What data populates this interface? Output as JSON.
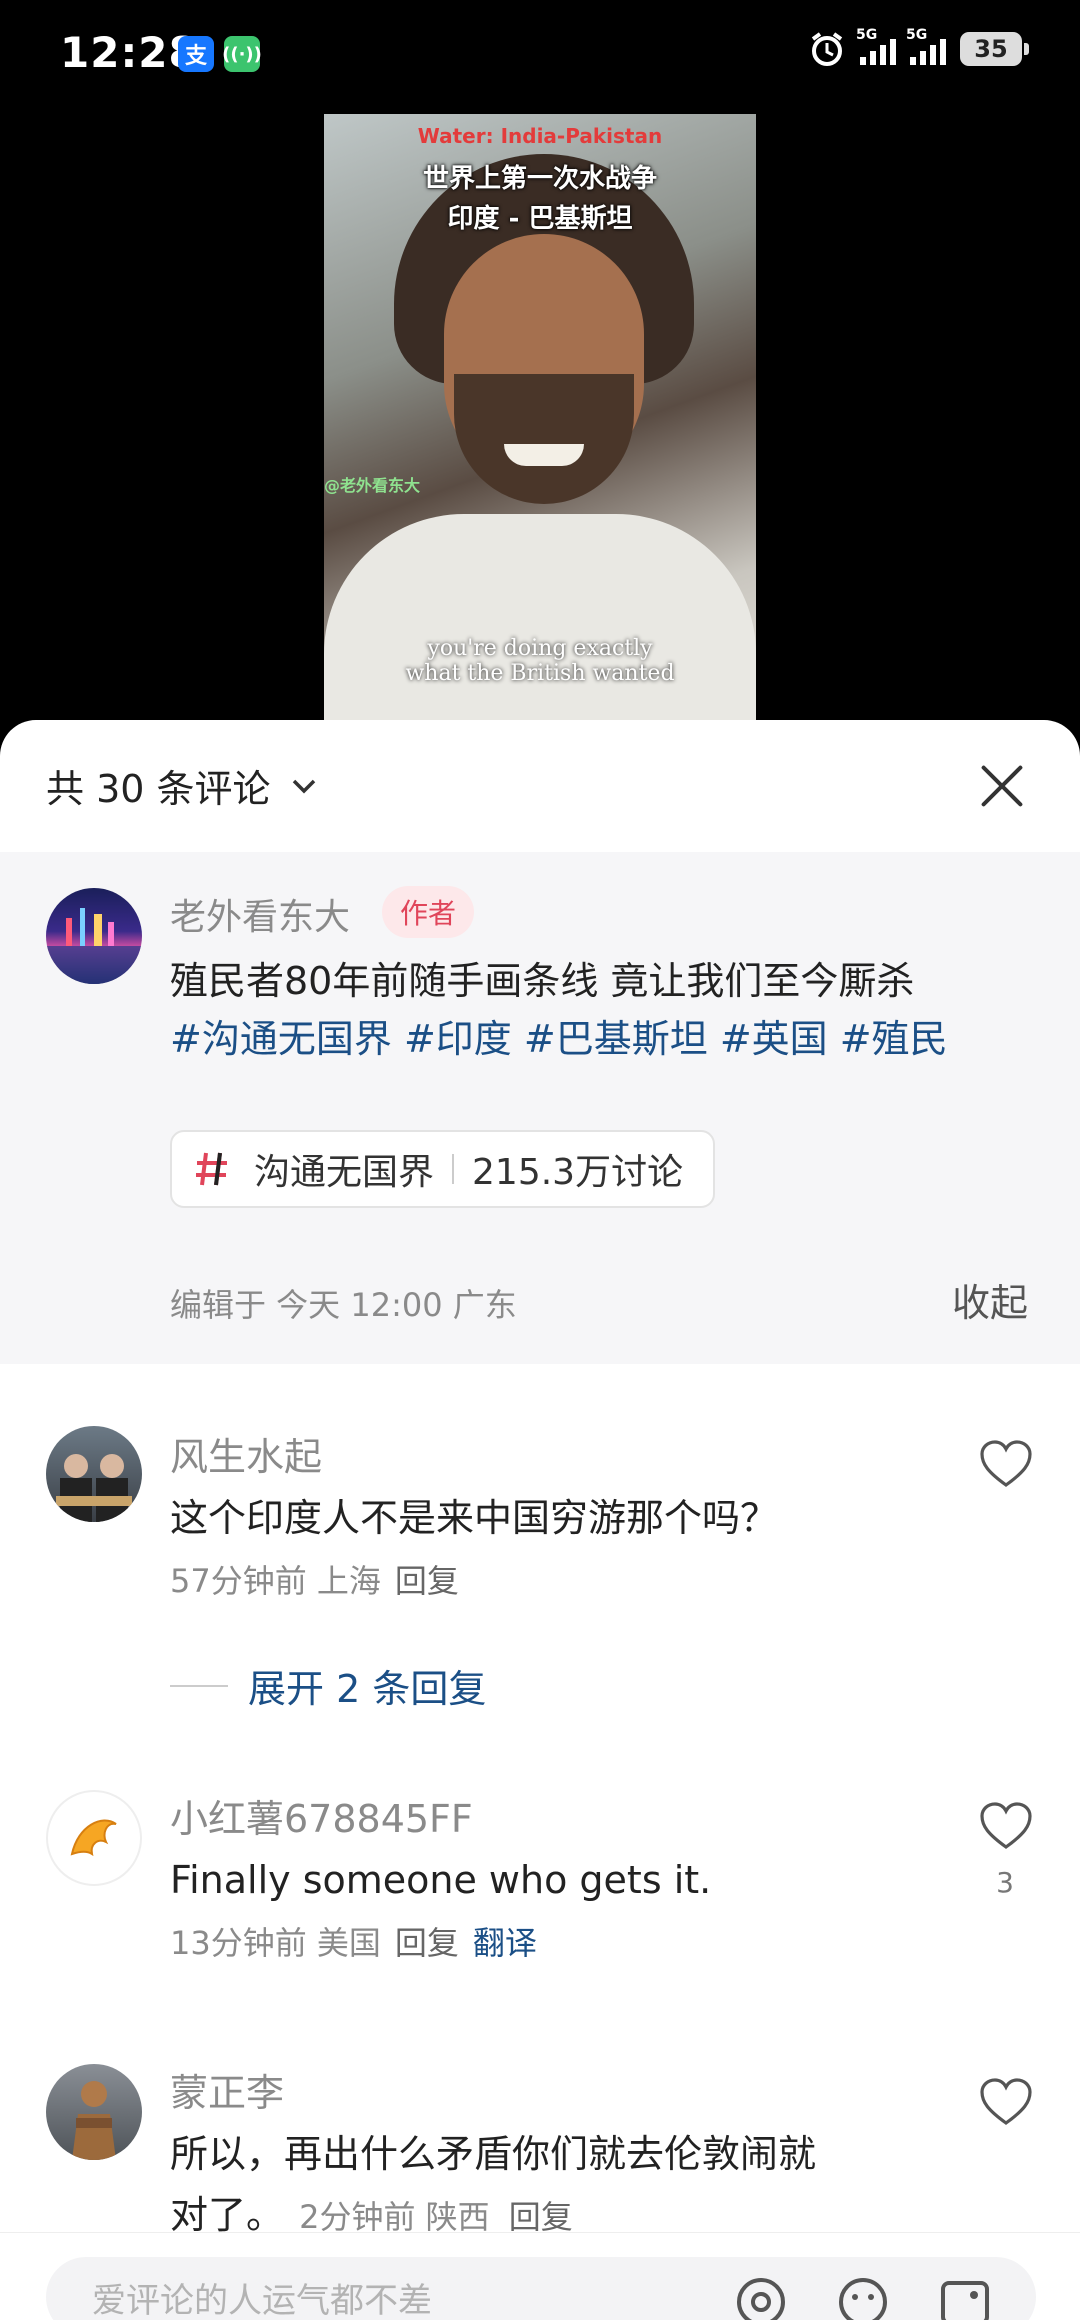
{
  "status_bar": {
    "time": "12:28",
    "alipay_glyph": "支",
    "network_1": "5G",
    "network_2": "5G",
    "battery": "35"
  },
  "video": {
    "title_en": "Water: India-Pakistan",
    "caption_line1": "世界上第一次水战争",
    "caption_line2": "印度 - 巴基斯坦",
    "watermark": "@老外看东大",
    "subtitle_line1": "you're doing exactly",
    "subtitle_line2": "what the British wanted"
  },
  "comments_header": {
    "title": "共 30 条评论"
  },
  "author_post": {
    "name": "老外看东大",
    "tag": "作者",
    "text": "殖民者80年前随手画条线 竟让我们至今厮杀",
    "hashtags": [
      "#沟通无国界",
      "#印度",
      "#巴基斯坦",
      "#英国",
      "#殖民"
    ],
    "topic": {
      "name": "沟通无国界",
      "count": "215.3万讨论"
    },
    "meta": "编辑于 今天 12:00 广东",
    "collapse_label": "收起"
  },
  "comments": [
    {
      "name": "风生水起",
      "text": "这个印度人不是来中国穷游那个吗？",
      "meta": "57分钟前 上海",
      "reply": "回复",
      "expand": "展开 2 条回复"
    },
    {
      "name": "小红薯678845FF",
      "text": "Finally someone who gets it.",
      "meta": "13分钟前 美国",
      "reply": "回复",
      "translate": "翻译",
      "likes": "3"
    },
    {
      "name": "蒙正李",
      "text_line1": "所以，再出什么矛盾你们就去伦敦闹就",
      "text_line2": "对了。",
      "meta": "2分钟前 陕西",
      "reply": "回复"
    }
  ],
  "input_bar": {
    "placeholder": "爱评论的人运气都不差",
    "icons": [
      "at-icon",
      "emoji-icon",
      "image-icon"
    ]
  },
  "colors": {
    "accent_blue": "#1b4f86",
    "author_tag_red": "#e0455a"
  }
}
